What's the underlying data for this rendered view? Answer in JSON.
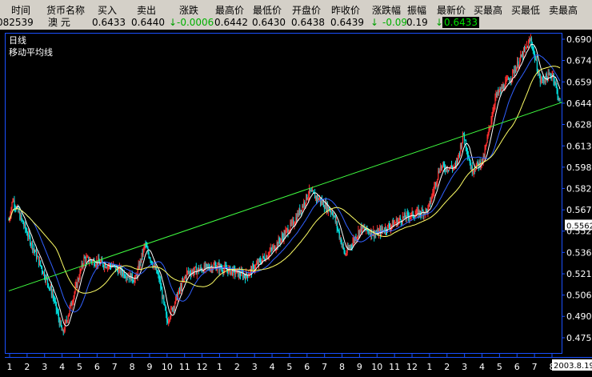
{
  "quote_bar": {
    "headers": [
      "时间",
      "货币名称",
      "买入",
      "卖出",
      "涨跌",
      "最高价",
      "最低价",
      "开盘价",
      "昨收价",
      "涨跌幅",
      "振幅",
      "最新价",
      "买最高",
      "买最低",
      "卖最高"
    ],
    "time": "082539",
    "currency_name": "澳 元",
    "buy": "0.6433",
    "sell": "0.6440",
    "change_arrow": "↓",
    "change": "-0.0006",
    "high": "0.6442",
    "low": "0.6430",
    "open": "0.6438",
    "prev_close": "0.6439",
    "change_pct_arrow": "↓",
    "change_pct": "-0.09",
    "amplitude": "0.19",
    "latest_arrow": "↓",
    "latest": "0.6433"
  },
  "chart": {
    "period_label": "日线",
    "indicator_label": "移动平均线",
    "current_price_tag": "0.5562",
    "date_label": "2003.8.19",
    "colors": {
      "background": "#000000",
      "frame": "#1a50ff",
      "up_candle": "#ff3030",
      "down_candle": "#00e0e0",
      "ma_short": "#ffffff",
      "ma_mid": "#3060ff",
      "ma_long": "#ffff66",
      "trendline": "#40ff40"
    }
  },
  "chart_data": {
    "type": "candlestick",
    "title": "",
    "y_axis": {
      "ticks": [
        "0.6900",
        "0.6747",
        "0.6593",
        "0.6440",
        "0.6287",
        "0.6133",
        "0.5980",
        "0.5827",
        "0.5673",
        "0.5520",
        "0.5367",
        "0.5213",
        "0.5060",
        "0.4907",
        "0.4753"
      ],
      "range": [
        0.4753,
        0.69
      ]
    },
    "x_axis": {
      "month_labels": [
        "1",
        "2",
        "3",
        "4",
        "5",
        "6",
        "7",
        "8",
        "9",
        "10",
        "11",
        "12",
        "1",
        "2",
        "3",
        "4",
        "5",
        "6",
        "7",
        "8",
        "9",
        "10",
        "11",
        "12",
        "1",
        "2",
        "3",
        "4",
        "5",
        "6",
        "7",
        "8"
      ]
    },
    "price_path_keypoints": [
      {
        "t": 0,
        "p": 0.56
      },
      {
        "t": 5,
        "p": 0.575
      },
      {
        "t": 25,
        "p": 0.548
      },
      {
        "t": 55,
        "p": 0.507
      },
      {
        "t": 68,
        "p": 0.478
      },
      {
        "t": 95,
        "p": 0.532
      },
      {
        "t": 130,
        "p": 0.527
      },
      {
        "t": 160,
        "p": 0.517
      },
      {
        "t": 172,
        "p": 0.542
      },
      {
        "t": 190,
        "p": 0.518
      },
      {
        "t": 200,
        "p": 0.487
      },
      {
        "t": 225,
        "p": 0.522
      },
      {
        "t": 260,
        "p": 0.527
      },
      {
        "t": 300,
        "p": 0.52
      },
      {
        "t": 335,
        "p": 0.54
      },
      {
        "t": 360,
        "p": 0.558
      },
      {
        "t": 380,
        "p": 0.58
      },
      {
        "t": 392,
        "p": 0.575
      },
      {
        "t": 410,
        "p": 0.565
      },
      {
        "t": 425,
        "p": 0.535
      },
      {
        "t": 445,
        "p": 0.554
      },
      {
        "t": 465,
        "p": 0.55
      },
      {
        "t": 500,
        "p": 0.562
      },
      {
        "t": 530,
        "p": 0.567
      },
      {
        "t": 545,
        "p": 0.598
      },
      {
        "t": 565,
        "p": 0.598
      },
      {
        "t": 575,
        "p": 0.622
      },
      {
        "t": 585,
        "p": 0.596
      },
      {
        "t": 600,
        "p": 0.603
      },
      {
        "t": 615,
        "p": 0.648
      },
      {
        "t": 635,
        "p": 0.663
      },
      {
        "t": 660,
        "p": 0.69
      },
      {
        "t": 672,
        "p": 0.66
      },
      {
        "t": 688,
        "p": 0.665
      },
      {
        "t": 697,
        "p": 0.6433
      }
    ],
    "series": [
      {
        "name": "",
        "type": "moving_average",
        "color": "#ffffff"
      },
      {
        "name": "",
        "type": "moving_average",
        "color": "#3060ff"
      },
      {
        "name": "",
        "type": "moving_average",
        "color": "#ffff66"
      }
    ],
    "trendlines": [
      {
        "from": {
          "t": 0,
          "p": 0.509
        },
        "to": {
          "t": 700,
          "p": 0.6447
        }
      }
    ]
  }
}
